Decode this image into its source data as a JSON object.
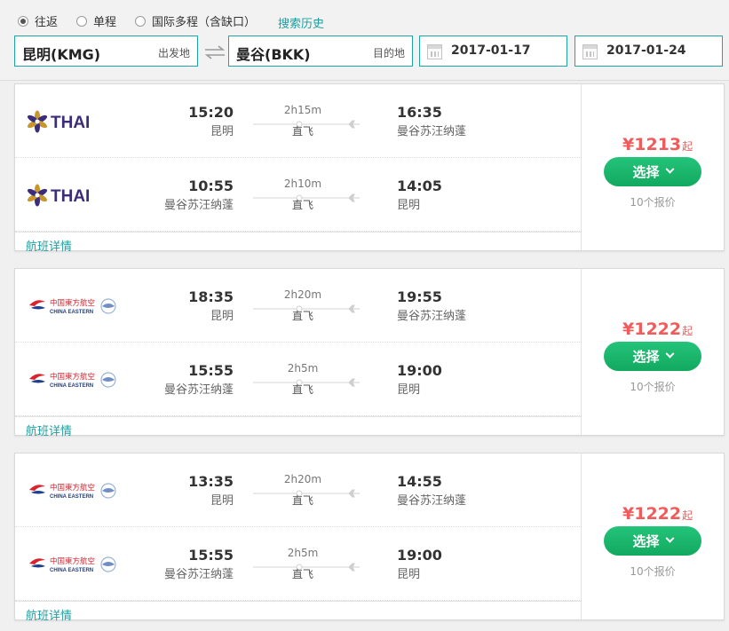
{
  "search": {
    "trip_types": [
      "往返",
      "单程",
      "国际多程（含缺口）"
    ],
    "selected_trip": "往返",
    "history_link": "搜索历史",
    "from_city": "昆明(KMG)",
    "from_hint": "出发地",
    "to_city": "曼谷(BKK)",
    "to_hint": "目的地",
    "depart_date": "2017-01-17",
    "return_date": "2017-01-24"
  },
  "results": [
    {
      "airline": "thai-airways",
      "airline_text": "THAI",
      "legs": [
        {
          "dep_time": "15:20",
          "dep_city": "昆明",
          "duration": "2h15m",
          "stops": "直飞",
          "arr_time": "16:35",
          "arr_city": "曼谷苏汪纳蓬"
        },
        {
          "dep_time": "10:55",
          "dep_city": "曼谷苏汪纳蓬",
          "duration": "2h10m",
          "stops": "直飞",
          "arr_time": "14:05",
          "arr_city": "昆明"
        }
      ],
      "detail_link": "航班详情",
      "price_symbol": "¥",
      "price": "1213",
      "price_suffix": "起",
      "select_label": "选择",
      "quotes": "10个报价"
    },
    {
      "airline": "china-eastern",
      "airline_text": "中国東方航空",
      "airline_text_en": "CHINA EASTERN",
      "legs": [
        {
          "dep_time": "18:35",
          "dep_city": "昆明",
          "duration": "2h20m",
          "stops": "直飞",
          "arr_time": "19:55",
          "arr_city": "曼谷苏汪纳蓬"
        },
        {
          "dep_time": "15:55",
          "dep_city": "曼谷苏汪纳蓬",
          "duration": "2h5m",
          "stops": "直飞",
          "arr_time": "19:00",
          "arr_city": "昆明"
        }
      ],
      "detail_link": "航班详情",
      "price_symbol": "¥",
      "price": "1222",
      "price_suffix": "起",
      "select_label": "选择",
      "quotes": "10个报价"
    },
    {
      "airline": "china-eastern",
      "airline_text": "中国東方航空",
      "airline_text_en": "CHINA EASTERN",
      "legs": [
        {
          "dep_time": "13:35",
          "dep_city": "昆明",
          "duration": "2h20m",
          "stops": "直飞",
          "arr_time": "14:55",
          "arr_city": "曼谷苏汪纳蓬"
        },
        {
          "dep_time": "15:55",
          "dep_city": "曼谷苏汪纳蓬",
          "duration": "2h5m",
          "stops": "直飞",
          "arr_time": "19:00",
          "arr_city": "昆明"
        }
      ],
      "detail_link": "航班详情",
      "price_symbol": "¥",
      "price": "1222",
      "price_suffix": "起",
      "select_label": "选择",
      "quotes": "10个报价"
    }
  ],
  "colors": {
    "accent": "#19a0a0",
    "price": "#f05b5b",
    "button": "#1db86b",
    "thai_purple": "#3c2d7a",
    "thai_gold": "#c8962c",
    "ce_red": "#d9232e",
    "ce_blue": "#1d3f8c"
  }
}
